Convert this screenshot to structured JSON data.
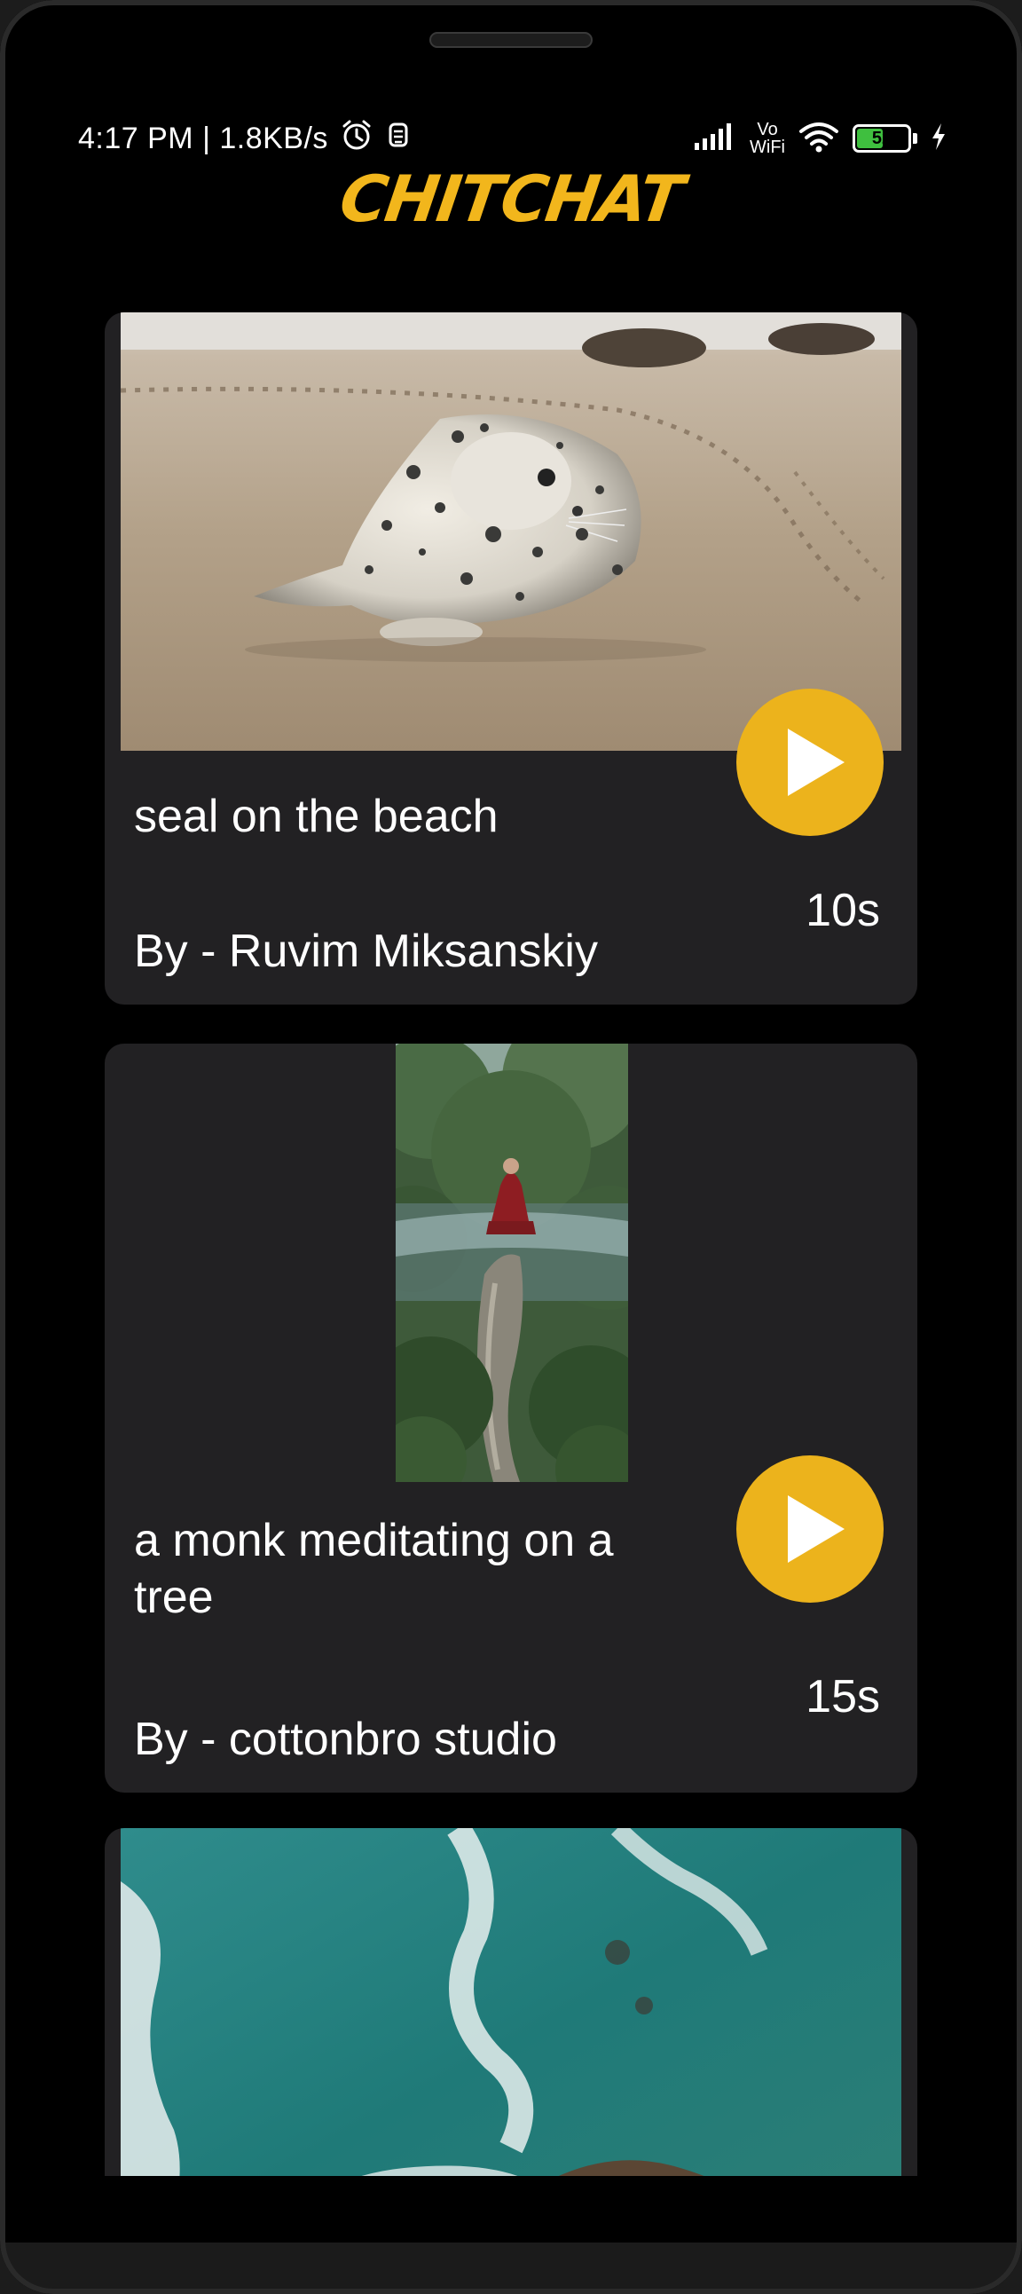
{
  "status_bar": {
    "time_and_speed": "4:17 PM | 1.8KB/s",
    "vowifi_top": "Vo",
    "vowifi_bottom": "WiFi",
    "battery_level": "52",
    "battery_fraction": 0.52
  },
  "app": {
    "title": "CHITCHAT",
    "accent_color": "#f2b61c",
    "card_background": "#222123"
  },
  "videos": [
    {
      "title": "seal on the beach",
      "author": "By - Ruvim Miksanskiy",
      "duration": "10s",
      "thumbnail": "seal-on-sand-photo"
    },
    {
      "title": "a monk meditating on a tree",
      "author": "By - cottonbro studio",
      "duration": "15s",
      "thumbnail": "monk-in-forest-photo"
    },
    {
      "title": "",
      "author": "",
      "duration": "",
      "thumbnail": "aerial-ocean-rocks-photo"
    }
  ]
}
